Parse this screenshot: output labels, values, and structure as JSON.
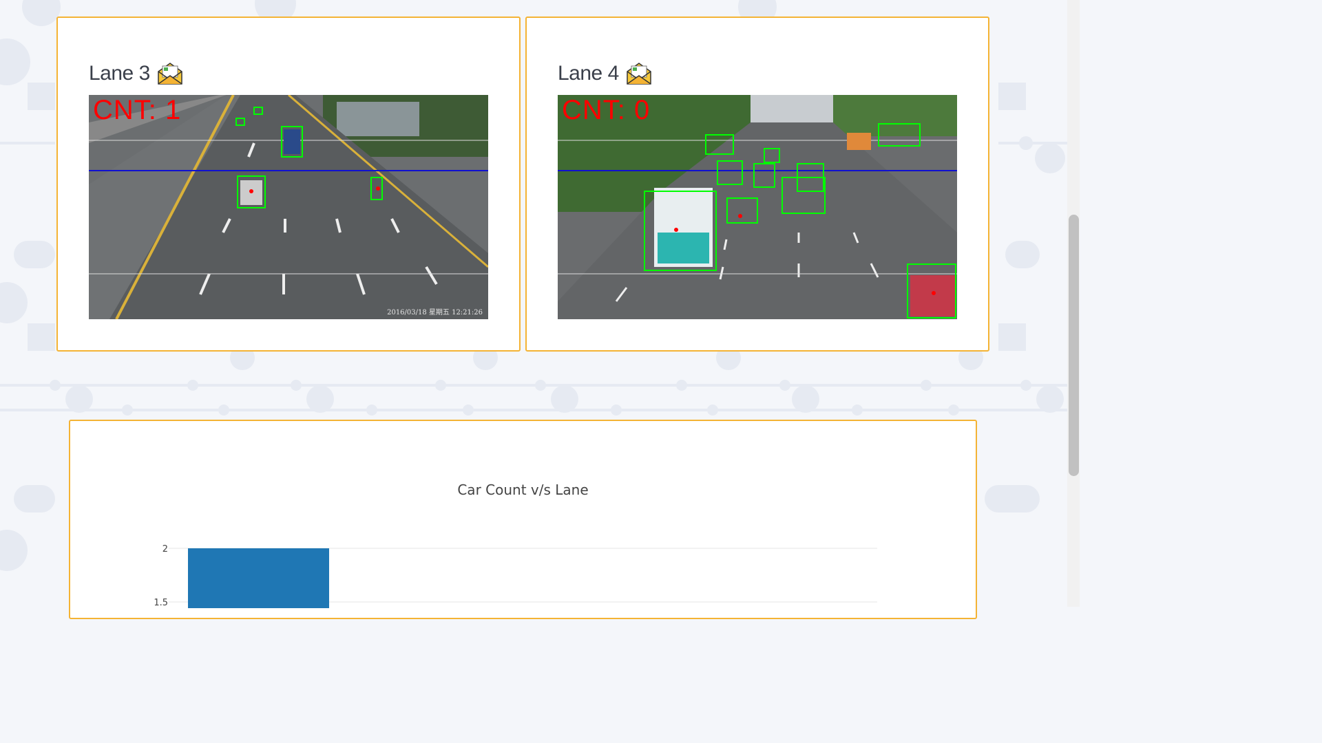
{
  "lanes": [
    {
      "title": "Lane 3",
      "icon": "open-envelope-icon",
      "count_label": "CNT: 1",
      "timestamp": "2016/03/18 星期五 12:21:26"
    },
    {
      "title": "Lane 4",
      "icon": "open-envelope-icon",
      "count_label": "CNT: 0"
    }
  ],
  "colors": {
    "card_border": "#f4b334",
    "bar": "#1f77b4",
    "count_text": "#ff0000",
    "detection_box": "#00ff00",
    "counting_line": "#0000ff"
  },
  "chart_data": {
    "type": "bar",
    "title": "Car Count v/s Lane",
    "y_ticks": [
      "2",
      "1.5"
    ],
    "series": [
      {
        "values": [
          2
        ]
      }
    ],
    "ylim_visible": [
      1.5,
      2
    ]
  }
}
